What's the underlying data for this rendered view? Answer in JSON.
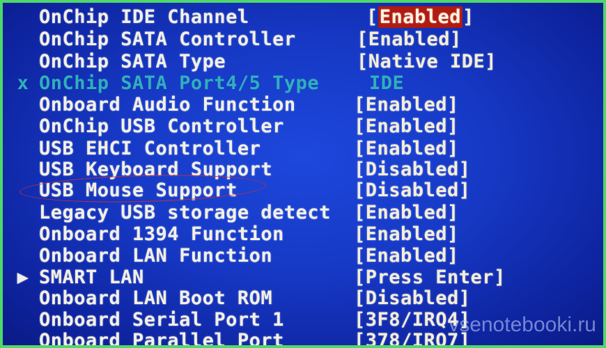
{
  "items": [
    {
      "label": "OnChip IDE Channel",
      "value": "Enabled",
      "selected": true
    },
    {
      "label": "OnChip SATA Controller",
      "value": "[Enabled]"
    },
    {
      "label": "OnChip SATA Type",
      "value": "[Native IDE]"
    },
    {
      "label": "OnChip SATA Port4/5 Type",
      "value": "IDE",
      "marker": "x",
      "disabled": true
    },
    {
      "label": "Onboard Audio Function",
      "value": "[Enabled]"
    },
    {
      "label": "OnChip USB Controller",
      "value": "[Enabled]"
    },
    {
      "label": "USB EHCI Controller",
      "value": "[Enabled]"
    },
    {
      "label": "USB Keyboard Support",
      "value": "[Disabled]"
    },
    {
      "label": "USB Mouse Support",
      "value": "[Disabled]",
      "circled": true
    },
    {
      "label": "Legacy USB storage detect",
      "value": "[Enabled]"
    },
    {
      "label": "Onboard 1394 Function",
      "value": "[Enabled]"
    },
    {
      "label": "Onboard LAN Function",
      "value": "[Enabled]"
    },
    {
      "label": "SMART LAN",
      "value": "[Press Enter]",
      "marker": "▶"
    },
    {
      "label": "Onboard LAN Boot ROM",
      "value": "[Disabled]"
    },
    {
      "label": "Onboard Serial Port 1",
      "value": "[3F8/IRQ4]"
    },
    {
      "label": "Onboard Parallel Port",
      "value": "[378/IRQ7]"
    }
  ],
  "watermark": "vsenotebooki.ru",
  "colors": {
    "background": "#1638c4",
    "highlight": "#b01a10",
    "frame": "#4fd86a",
    "circle": "#c03040"
  }
}
